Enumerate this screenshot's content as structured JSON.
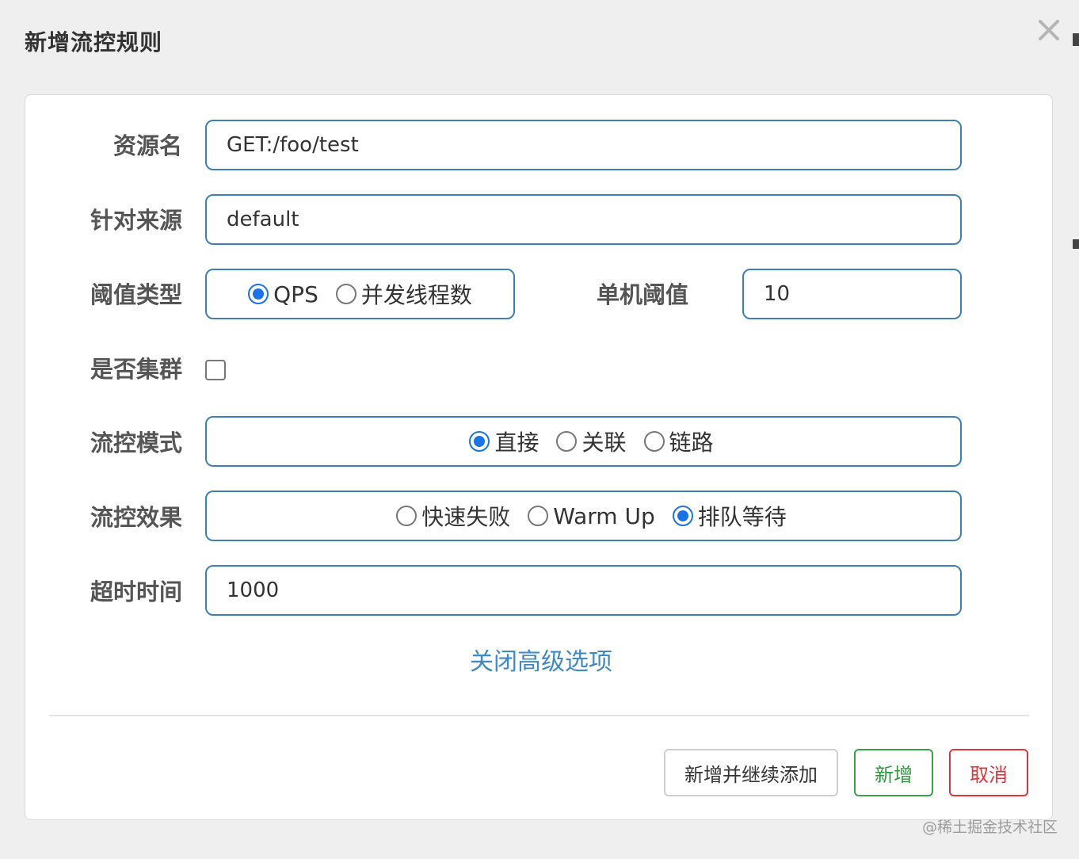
{
  "dialog": {
    "title": "新增流控规则",
    "close_icon": "close-icon"
  },
  "form": {
    "resource": {
      "label": "资源名",
      "value": "GET:/foo/test"
    },
    "source": {
      "label": "针对来源",
      "value": "default"
    },
    "threshold_type": {
      "label": "阈值类型",
      "options": [
        {
          "label": "QPS",
          "checked": true
        },
        {
          "label": "并发线程数",
          "checked": false
        }
      ]
    },
    "single_threshold": {
      "label": "单机阈值",
      "value": "10"
    },
    "cluster": {
      "label": "是否集群",
      "checked": false
    },
    "flow_mode": {
      "label": "流控模式",
      "options": [
        {
          "label": "直接",
          "checked": true
        },
        {
          "label": "关联",
          "checked": false
        },
        {
          "label": "链路",
          "checked": false
        }
      ]
    },
    "flow_effect": {
      "label": "流控效果",
      "options": [
        {
          "label": "快速失败",
          "checked": false
        },
        {
          "label": "Warm Up",
          "checked": false
        },
        {
          "label": "排队等待",
          "checked": true
        }
      ]
    },
    "timeout": {
      "label": "超时时间",
      "value": "1000"
    },
    "advanced_toggle": "关闭高级选项"
  },
  "buttons": {
    "continue_add": "新增并继续添加",
    "add": "新增",
    "cancel": "取消"
  },
  "colors": {
    "accent": "#1a73e8",
    "field_border": "#3d7fb8",
    "link": "#3d8ac6",
    "success": "#2e9a40",
    "danger": "#d9363e"
  },
  "watermark": "@稀土掘金技术社区"
}
